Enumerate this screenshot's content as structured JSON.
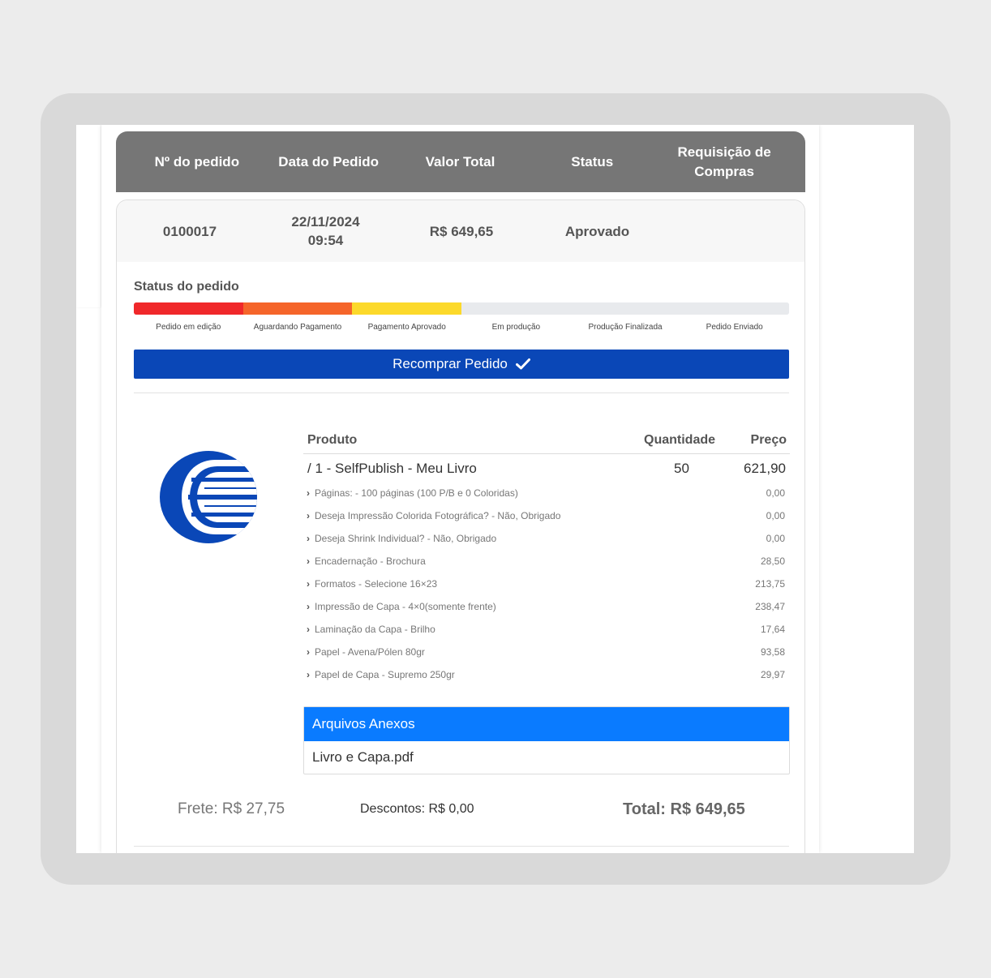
{
  "header": {
    "columns": [
      "Nº do pedido",
      "Data do Pedido",
      "Valor Total",
      "Status",
      "Requisição de Compras"
    ]
  },
  "order": {
    "number": "0100017",
    "date": "22/11/2024",
    "time": "09:54",
    "total": "R$ 649,65",
    "status": "Aprovado"
  },
  "status_section": {
    "title": "Status do pedido",
    "steps": [
      "Pedido em edição",
      "Aguardando Pagamento",
      "Pagamento Aprovado",
      "Em produção",
      "Produção Finalizada",
      "Pedido Enviado"
    ],
    "completed_steps": 3,
    "step_colors": [
      "#f0282a",
      "#f5652a",
      "#fcd92b"
    ],
    "remaining_color": "#e8eaed"
  },
  "rebuy_button": {
    "label": "Recomprar Pedido",
    "icon": "check-icon"
  },
  "product_table": {
    "headers": {
      "product": "Produto",
      "quantity": "Quantidade",
      "price": "Preço"
    },
    "main": {
      "name": "/ 1 - SelfPublish - Meu Livro",
      "quantity": "50",
      "price": "621,90"
    },
    "options": [
      {
        "label": "Páginas: - 100 páginas (100 P/B e 0 Coloridas)",
        "price": "0,00"
      },
      {
        "label": "Deseja Impressão Colorida Fotográfica? - Não, Obrigado",
        "price": "0,00"
      },
      {
        "label": "Deseja Shrink Individual? - Não, Obrigado",
        "price": "0,00"
      },
      {
        "label": "Encadernação - Brochura",
        "price": "28,50"
      },
      {
        "label": "Formatos - Selecione 16×23",
        "price": "213,75"
      },
      {
        "label": "Impressão de Capa - 4×0(somente frente)",
        "price": "238,47"
      },
      {
        "label": "Laminação da Capa - Brilho",
        "price": "17,64"
      },
      {
        "label": "Papel - Avena/Pólen 80gr",
        "price": "93,58"
      },
      {
        "label": "Papel de Capa - Supremo 250gr",
        "price": "29,97"
      }
    ]
  },
  "attachments": {
    "title": "Arquivos Anexos",
    "files": [
      "Livro e Capa.pdf"
    ]
  },
  "summary": {
    "frete": "Frete: R$ 27,75",
    "descontos": "Descontos: R$ 0,00",
    "total": "Total: R$ 649,65"
  },
  "colors": {
    "brand_blue": "#0a47b7",
    "attach_blue": "#0a7bff",
    "header_gray": "#767676"
  }
}
